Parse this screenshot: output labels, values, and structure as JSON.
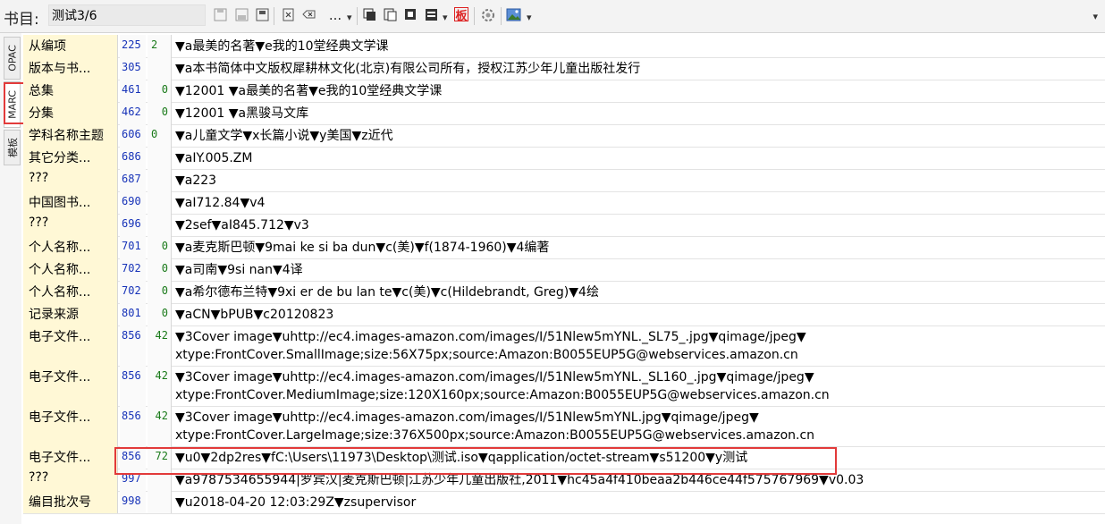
{
  "toolbar": {
    "label": "书目:",
    "record_value": "测试3/6",
    "more": "...",
    "icons": [
      "save-all-icon",
      "save-icon",
      "save-to-icon",
      "delete-icon",
      "clear-icon",
      "more-icon",
      "copy-icon",
      "paste-icon",
      "duplicate-icon",
      "layout-icon",
      "template-icon",
      "settings-icon",
      "image-icon"
    ]
  },
  "sidetabs": [
    "OPAC",
    "MARC",
    "模板"
  ],
  "rows": [
    {
      "name": "从编项",
      "tag": "225",
      "ind": "2",
      "ind_left": true,
      "content": [
        "▼a最美的名著▼e我的10堂经典文学课"
      ]
    },
    {
      "name": "版本与书...",
      "tag": "305",
      "ind": "",
      "content": [
        "▼a本书简体中文版权犀耕林文化(北京)有限公司所有，授权江苏少年儿童出版社发行"
      ]
    },
    {
      "name": "总集",
      "tag": "461",
      "ind": "0",
      "content": [
        "▼12001 ▼a最美的名著▼e我的10堂经典文学课"
      ]
    },
    {
      "name": "分集",
      "tag": "462",
      "ind": "0",
      "content": [
        "▼12001 ▼a黑骏马文库"
      ]
    },
    {
      "name": "学科名称主题",
      "tag": "606",
      "ind": "0",
      "ind_left": true,
      "content": [
        "▼a儿童文学▼x长篇小说▼y美国▼z近代"
      ]
    },
    {
      "name": "其它分类...",
      "tag": "686",
      "ind": "",
      "content": [
        "▼aIY.005.ZM"
      ]
    },
    {
      "name": "???",
      "tag": "687",
      "ind": "",
      "content": [
        "▼a223"
      ]
    },
    {
      "name": "中国图书...",
      "tag": "690",
      "ind": "",
      "content": [
        "▼aI712.84▼v4"
      ]
    },
    {
      "name": "???",
      "tag": "696",
      "ind": "",
      "content": [
        "▼2sef▼aI845.712▼v3"
      ]
    },
    {
      "name": "个人名称...",
      "tag": "701",
      "ind": "0",
      "content": [
        "▼a麦克斯巴顿▼9mai ke si ba dun▼c(美)▼f(1874-1960)▼4编著"
      ]
    },
    {
      "name": "个人名称...",
      "tag": "702",
      "ind": "0",
      "content": [
        "▼a司南▼9si nan▼4译"
      ]
    },
    {
      "name": "个人名称...",
      "tag": "702",
      "ind": "0",
      "content": [
        "▼a希尔德布兰特▼9xi er de bu lan te▼c(美)▼c(Hildebrandt, Greg)▼4绘"
      ]
    },
    {
      "name": "记录来源",
      "tag": "801",
      "ind": "0",
      "content": [
        "▼aCN▼bPUB▼c20120823"
      ]
    },
    {
      "name": "电子文件...",
      "tag": "856",
      "ind": "42",
      "content": [
        "▼3Cover image▼uhttp://ec4.images-amazon.com/images/I/51Nlew5mYNL._SL75_.jpg▼qimage/jpeg▼",
        "xtype:FrontCover.SmallImage;size:56X75px;source:Amazon:B0055EUP5G@webservices.amazon.cn"
      ]
    },
    {
      "name": "电子文件...",
      "tag": "856",
      "ind": "42",
      "content": [
        "▼3Cover image▼uhttp://ec4.images-amazon.com/images/I/51Nlew5mYNL._SL160_.jpg▼qimage/jpeg▼",
        "xtype:FrontCover.MediumImage;size:120X160px;source:Amazon:B0055EUP5G@webservices.amazon.cn"
      ]
    },
    {
      "name": "电子文件...",
      "tag": "856",
      "ind": "42",
      "content": [
        "▼3Cover image▼uhttp://ec4.images-amazon.com/images/I/51Nlew5mYNL.jpg▼qimage/jpeg▼",
        "xtype:FrontCover.LargeImage;size:376X500px;source:Amazon:B0055EUP5G@webservices.amazon.cn"
      ]
    },
    {
      "name": "电子文件...",
      "tag": "856",
      "ind": "72",
      "content": [
        "▼u0▼2dp2res▼fC:\\Users\\11973\\Desktop\\测试.iso▼qapplication/octet-stream▼s51200▼y测试"
      ]
    },
    {
      "name": "???",
      "tag": "997",
      "ind": "",
      "content": [
        "▼a9787534655944|罗宾汉|麦克斯巴顿|江苏少年儿童出版社,2011▼hc45a4f410beaa2b446ce44f575767969▼v0.03"
      ]
    },
    {
      "name": "编目批次号",
      "tag": "998",
      "ind": "",
      "content": [
        "▼u2018-04-20 12:03:29Z▼zsupervisor"
      ]
    }
  ]
}
